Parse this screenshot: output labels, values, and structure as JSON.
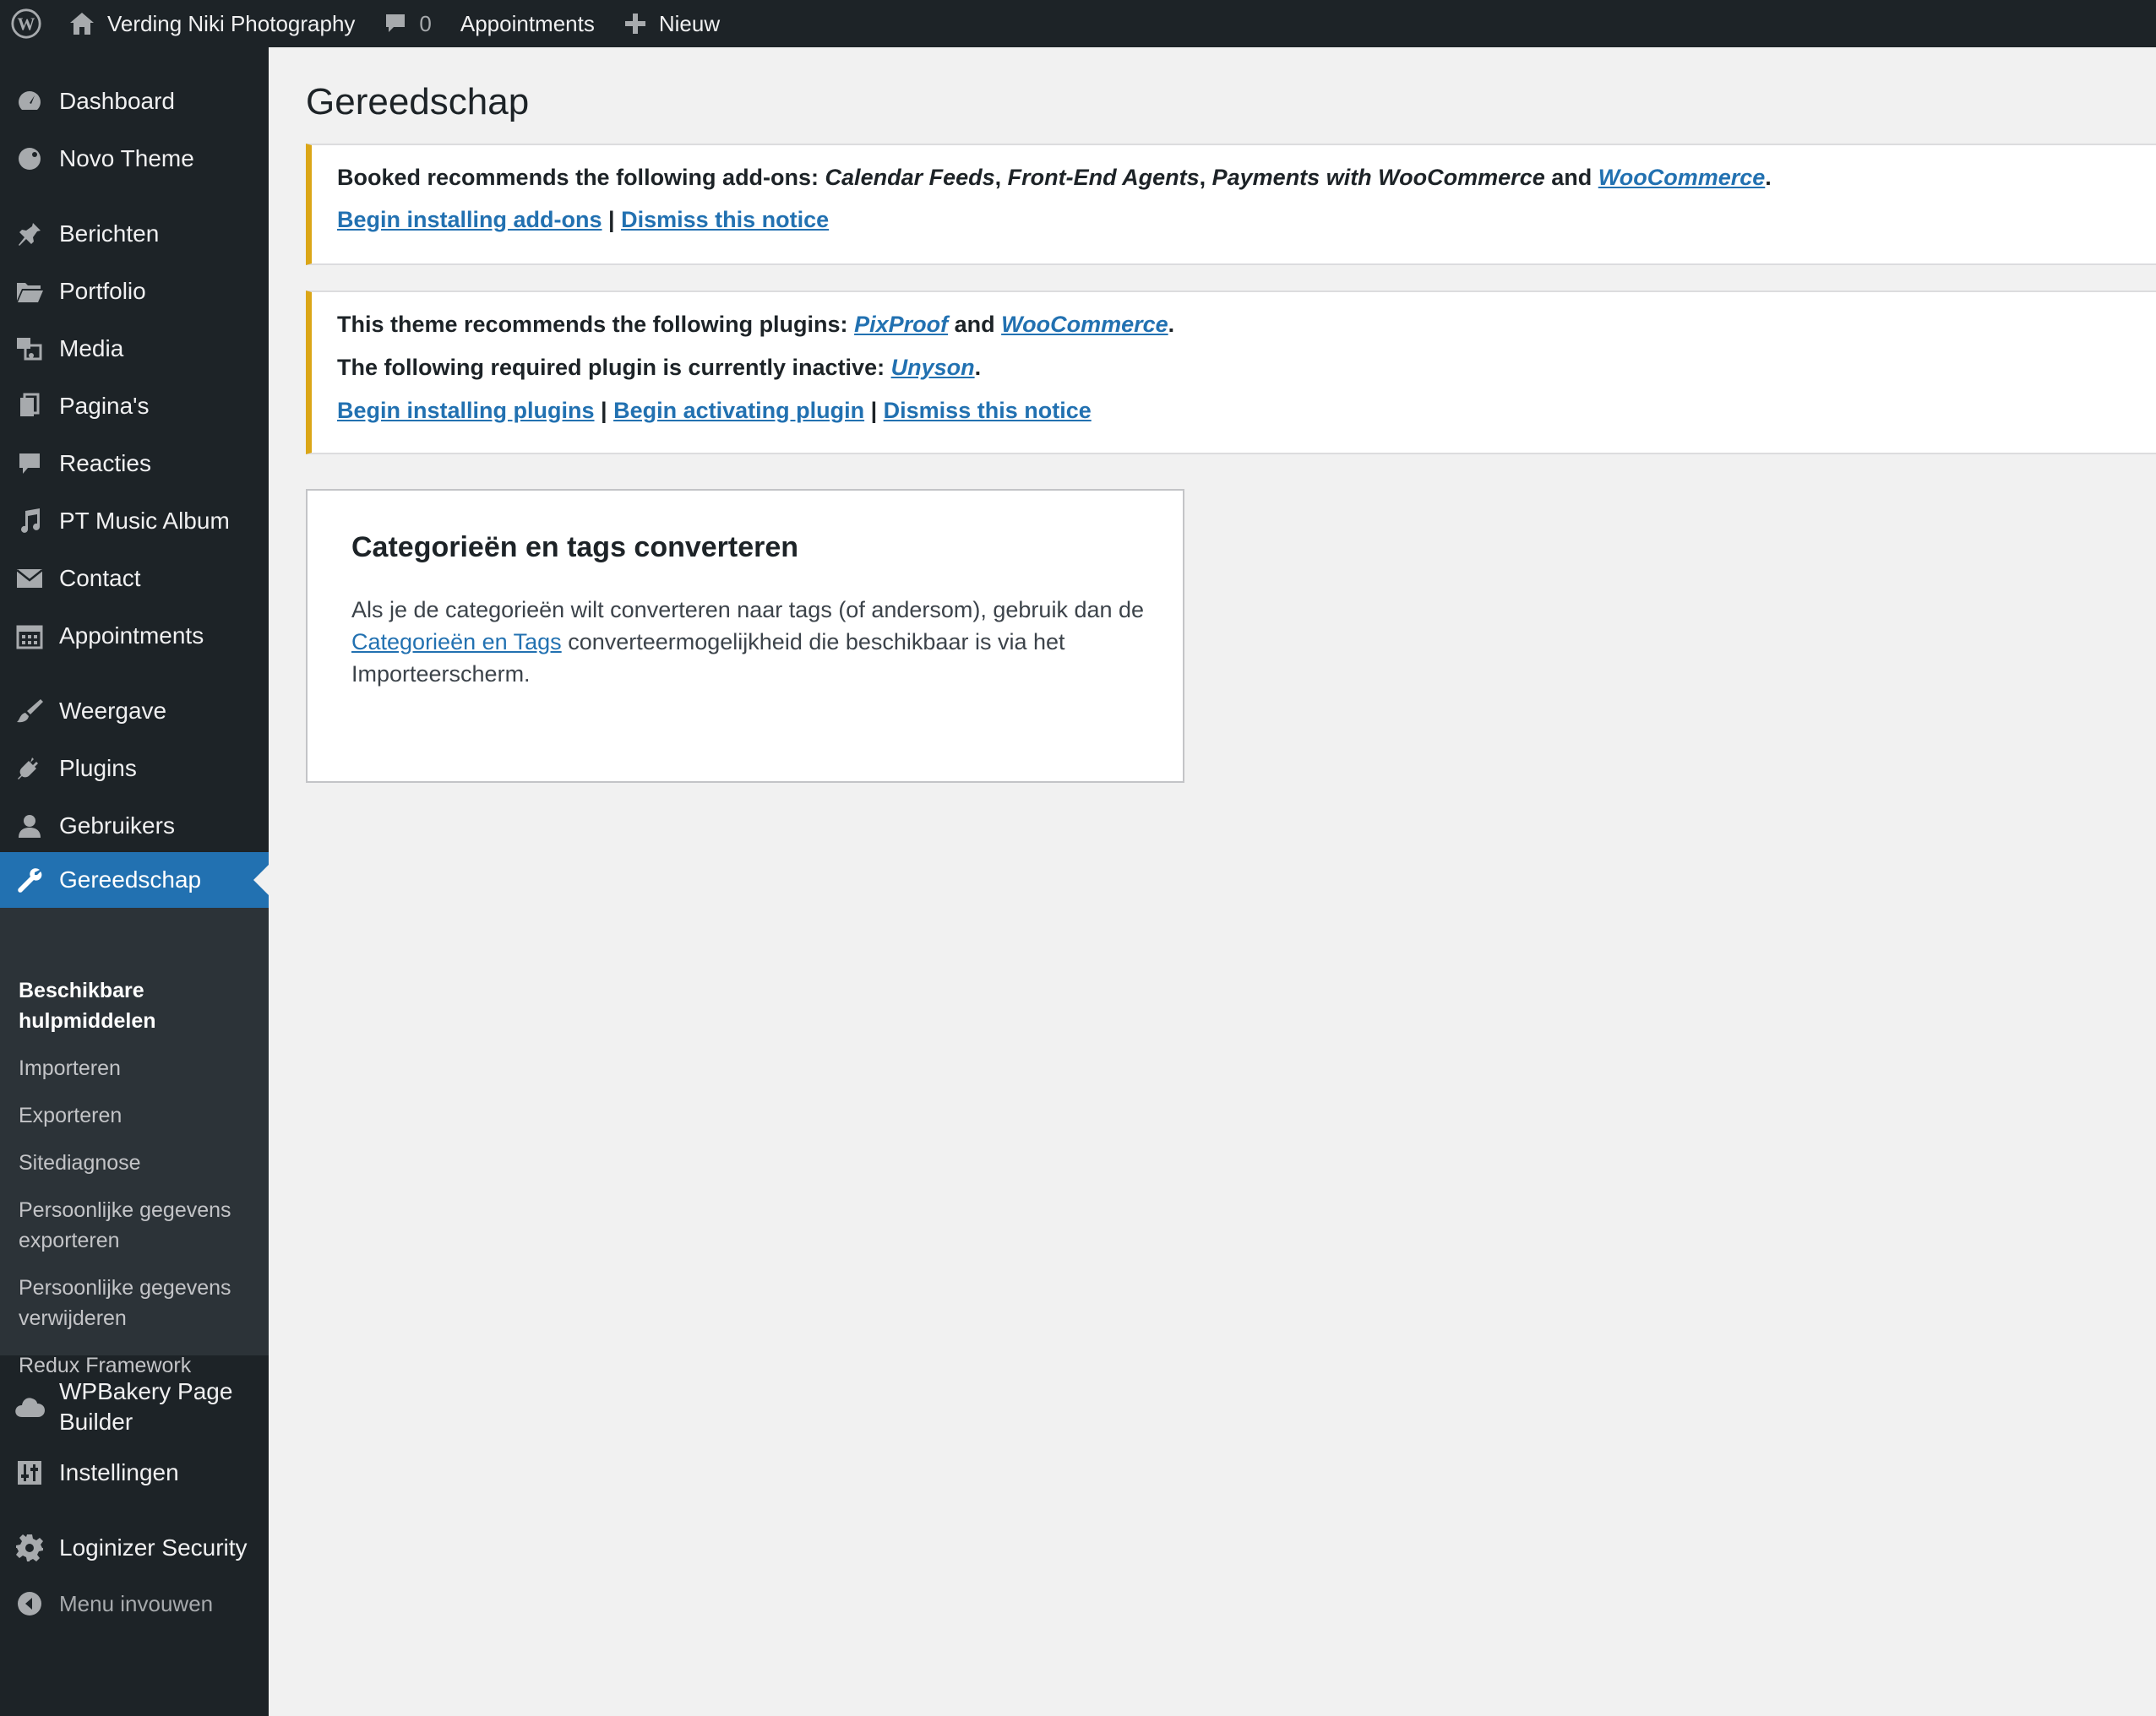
{
  "adminbar": {
    "site_name": "Verding Niki Photography",
    "comments_count": "0",
    "appointments": "Appointments",
    "new": "Nieuw"
  },
  "sidebar": {
    "items": {
      "dashboard": "Dashboard",
      "novo_theme": "Novo Theme",
      "berichten": "Berichten",
      "portfolio": "Portfolio",
      "media": "Media",
      "paginas": "Pagina's",
      "reacties": "Reacties",
      "pt_music_album": "PT Music Album",
      "contact": "Contact",
      "appointments": "Appointments",
      "weergave": "Weergave",
      "plugins": "Plugins",
      "gebruikers": "Gebruikers",
      "gereedschap": "Gereedschap",
      "wpbakery_line1": "WPBakery Page",
      "wpbakery_line2": "Builder",
      "instellingen": "Instellingen",
      "loginizer": "Loginizer Security",
      "collapse": "Menu invouwen"
    },
    "submenu": {
      "beschikbare_line1": "Beschikbare",
      "beschikbare_line2": "hulpmiddelen",
      "importeren": "Importeren",
      "exporteren": "Exporteren",
      "sitediagnose": "Sitediagnose",
      "persoonlijk_exp_line1": "Persoonlijke gegevens",
      "persoonlijk_exp_line2": "exporteren",
      "persoonlijk_del_line1": "Persoonlijke gegevens",
      "persoonlijk_del_line2": "verwijderen",
      "redux": "Redux Framework"
    }
  },
  "main": {
    "title": "Gereedschap",
    "notice1": {
      "prefix": "Booked recommends the following add-ons: ",
      "addon1": "Calendar Feeds",
      "sep1": ", ",
      "addon2": "Front-End Agents",
      "sep2": ", ",
      "addon3": "Payments with WooCommerce",
      "and": " and ",
      "addon4": "WooCommerce",
      "end": ".",
      "link_install": "Begin installing add-ons",
      "pipe": " | ",
      "link_dismiss": "Dismiss this notice"
    },
    "notice2": {
      "prefix": "This theme recommends the following plugins: ",
      "plugin1": "PixProof",
      "and": " and ",
      "plugin2": "WooCommerce",
      "end": ".",
      "required_prefix": "The following required plugin is currently inactive: ",
      "required_plugin": "Unyson",
      "required_end": ".",
      "link_install": "Begin installing plugins",
      "pipe1": " | ",
      "link_activate": "Begin activating plugin",
      "pipe2": " | ",
      "link_dismiss": "Dismiss this notice"
    },
    "card": {
      "title": "Categorieën en tags converteren",
      "text_before": "Als je de categorieën wilt converteren naar tags (of andersom), gebruik dan de ",
      "link": "Categorieën en Tags",
      "text_after": " converteermogelijkheid die beschikbaar is via het Importeerscherm."
    }
  },
  "colors": {
    "admin_dark": "#1d2327",
    "submenu_bg": "#2c3338",
    "accent": "#2271b1",
    "notice_warning": "#dba617",
    "background": "#f1f1f1"
  }
}
